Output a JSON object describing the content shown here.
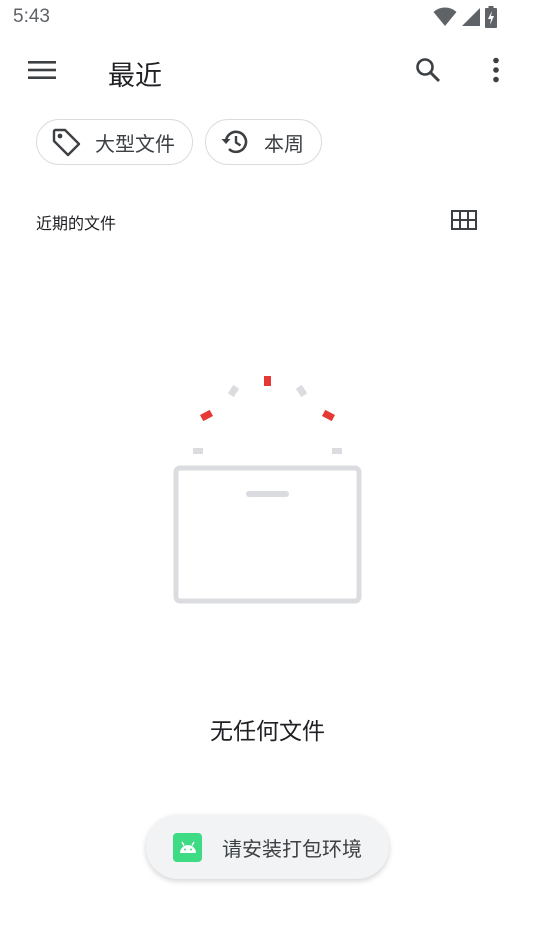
{
  "status_bar": {
    "time": "5:43",
    "icons": [
      "wifi-icon",
      "cell-signal-icon",
      "battery-charging-icon"
    ]
  },
  "app_bar": {
    "title": "最近",
    "nav_icon": "menu-icon",
    "actions": [
      "search-icon",
      "more-vert-icon"
    ]
  },
  "filter_chips": [
    {
      "label": "大型文件",
      "icon": "label-tag-icon"
    },
    {
      "label": "本周",
      "icon": "history-icon"
    }
  ],
  "section": {
    "title": "近期的文件",
    "view_toggle_icon": "grid-view-icon"
  },
  "empty_state": {
    "message": "无任何文件",
    "accent_color": "#e53935",
    "neutral_color": "#dadce0"
  },
  "toast": {
    "text": "请安装打包环境",
    "icon": "android-icon",
    "icon_color": "#3ddc84"
  }
}
